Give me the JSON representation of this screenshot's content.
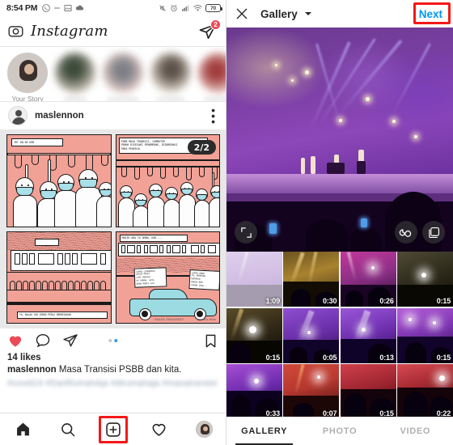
{
  "status_bar": {
    "time": "8:54 PM",
    "left_icons": [
      "whatsapp-icon",
      "dash-icon",
      "photo-icon",
      "cloud-icon"
    ],
    "right_icons": [
      "mute-icon",
      "alarm-icon",
      "signal-icon",
      "wifi-icon"
    ],
    "battery_level": "70"
  },
  "instagram": {
    "wordmark": "Instagram",
    "camera_icon": "camera-icon",
    "direct_icon": "direct-message-icon",
    "direct_badge": "2",
    "stories": [
      {
        "label": "Your Story",
        "blurred": false
      },
      {
        "label": "adhitya",
        "blurred": true
      },
      {
        "label": "pramudya",
        "blurred": true
      },
      {
        "label": "nurhaliza",
        "blurred": true
      },
      {
        "label": "wulandari",
        "blurred": true
      }
    ],
    "post": {
      "username": "maslennon",
      "more_icon": "overflow-menu-icon",
      "page_indicator": "2/2",
      "panels": [
        {
          "caption": "JKT 08.05 WIB"
        },
        {
          "caption": "PSBB MASA TRANSISI, COMMUTER\nPENUH DISESAKI PENUMPANG, DIDOMINASI\nPARA PEKERJA"
        },
        {
          "caption": "YA, WALAU TAK SEMUA PERLU BERDESAKAN"
        },
        {
          "caption": "MASIH ADA YG AMAN, KOK...."
        }
      ],
      "bubbles": [
        "SUAMI LEMBURNYA\nBIKIN MACET\nLAGI MENUJU\nKE RUMAH, SAYA\nBAWA MOBIL AJA",
        "LEBIH AMAN\nYA, MUMPUNG\nKEMARIN\nHARGA BBM\nTURUN JUGA..."
      ],
      "signature_title": "\"MASA TRANSISI\"",
      "signature_author": "pandu tilas",
      "actions": {
        "like_icon": "heart-filled-icon",
        "comment_icon": "comment-bubble-icon",
        "share_icon": "share-paperplane-icon",
        "bookmark_icon": "bookmark-icon"
      },
      "carousel_dots": 2,
      "carousel_active_index": 1,
      "likes": "14 likes",
      "caption_user": "maslennon",
      "caption_text": "Masa Transisi PSBB dan kita.",
      "hashtags": "#covid19 #DariRumahAja #dirumahaja #masatransisi"
    },
    "bottom_nav": [
      {
        "name": "home",
        "icon": "home-icon",
        "highlighted": false
      },
      {
        "name": "search",
        "icon": "search-icon",
        "highlighted": false
      },
      {
        "name": "add-post",
        "icon": "plus-square-icon",
        "highlighted": true
      },
      {
        "name": "activity",
        "icon": "heart-outline-icon",
        "highlighted": false
      },
      {
        "name": "profile",
        "icon": "profile-avatar-icon",
        "highlighted": false
      }
    ]
  },
  "gallery": {
    "close_icon": "close-x-icon",
    "title": "Gallery",
    "dropdown_icon": "chevron-down-icon",
    "next_label": "Next",
    "next_highlighted": true,
    "preview": {
      "expand_icon": "expand-arrows-icon",
      "boomerang_icon": "infinity-boomerang-icon",
      "multiselect_icon": "multi-select-icon"
    },
    "thumbnails": [
      {
        "duration": "1:09",
        "selected": true,
        "scene": "purple-stage"
      },
      {
        "duration": "0:30",
        "selected": false,
        "scene": "amber-stage"
      },
      {
        "duration": "0:26",
        "selected": false,
        "scene": "magenta-stage"
      },
      {
        "duration": "0:15",
        "selected": false,
        "scene": "dark-flare"
      },
      {
        "duration": "0:15",
        "selected": false,
        "scene": "white-flare"
      },
      {
        "duration": "0:05",
        "selected": false,
        "scene": "violet-beam"
      },
      {
        "duration": "0:13",
        "selected": false,
        "scene": "violet-beam"
      },
      {
        "duration": "0:15",
        "selected": false,
        "scene": "purple-crowd"
      },
      {
        "duration": "0:33",
        "selected": false,
        "scene": "violet-hands"
      },
      {
        "duration": "0:07",
        "selected": false,
        "scene": "red-stage"
      },
      {
        "duration": "0:15",
        "selected": false,
        "scene": "red-crowd"
      },
      {
        "duration": "0:22",
        "selected": false,
        "scene": "red-crowd"
      }
    ],
    "tabs": [
      {
        "label": "GALLERY",
        "active": true
      },
      {
        "label": "PHOTO",
        "active": false
      },
      {
        "label": "VIDEO",
        "active": false
      }
    ]
  },
  "colors": {
    "ig_blue": "#0095f6",
    "ig_red_badge": "#ed4956",
    "highlight_red": "#f51818",
    "comic_pink": "#f2a196",
    "comic_cyan": "#9ddbe3"
  }
}
